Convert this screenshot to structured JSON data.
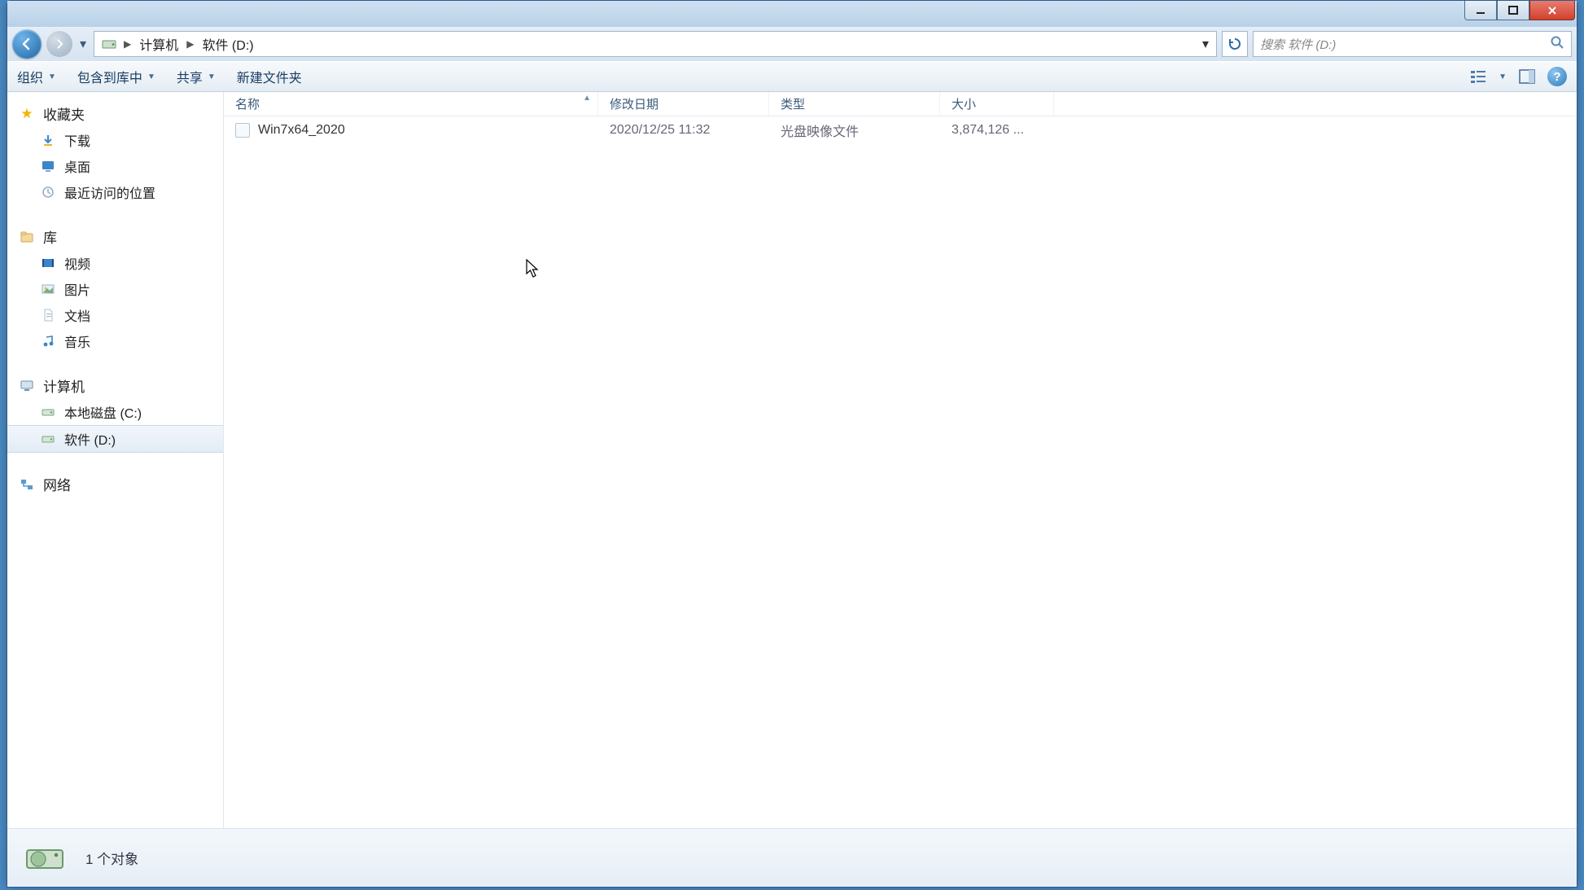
{
  "breadcrumb": {
    "seg1": "计算机",
    "seg2": "软件 (D:)"
  },
  "search": {
    "placeholder": "搜索 软件 (D:)"
  },
  "toolbar": {
    "organize": "组织",
    "include": "包含到库中",
    "share": "共享",
    "newfolder": "新建文件夹"
  },
  "columns": {
    "name": "名称",
    "date": "修改日期",
    "type": "类型",
    "size": "大小"
  },
  "files": [
    {
      "name": "Win7x64_2020",
      "date": "2020/12/25 11:32",
      "type": "光盘映像文件",
      "size": "3,874,126 ..."
    }
  ],
  "sidebar": {
    "fav": "收藏夹",
    "fav_items": [
      "下载",
      "桌面",
      "最近访问的位置"
    ],
    "lib": "库",
    "lib_items": [
      "视频",
      "图片",
      "文档",
      "音乐"
    ],
    "comp": "计算机",
    "comp_items": [
      "本地磁盘 (C:)",
      "软件 (D:)"
    ],
    "net": "网络"
  },
  "status": {
    "text": "1 个对象"
  }
}
